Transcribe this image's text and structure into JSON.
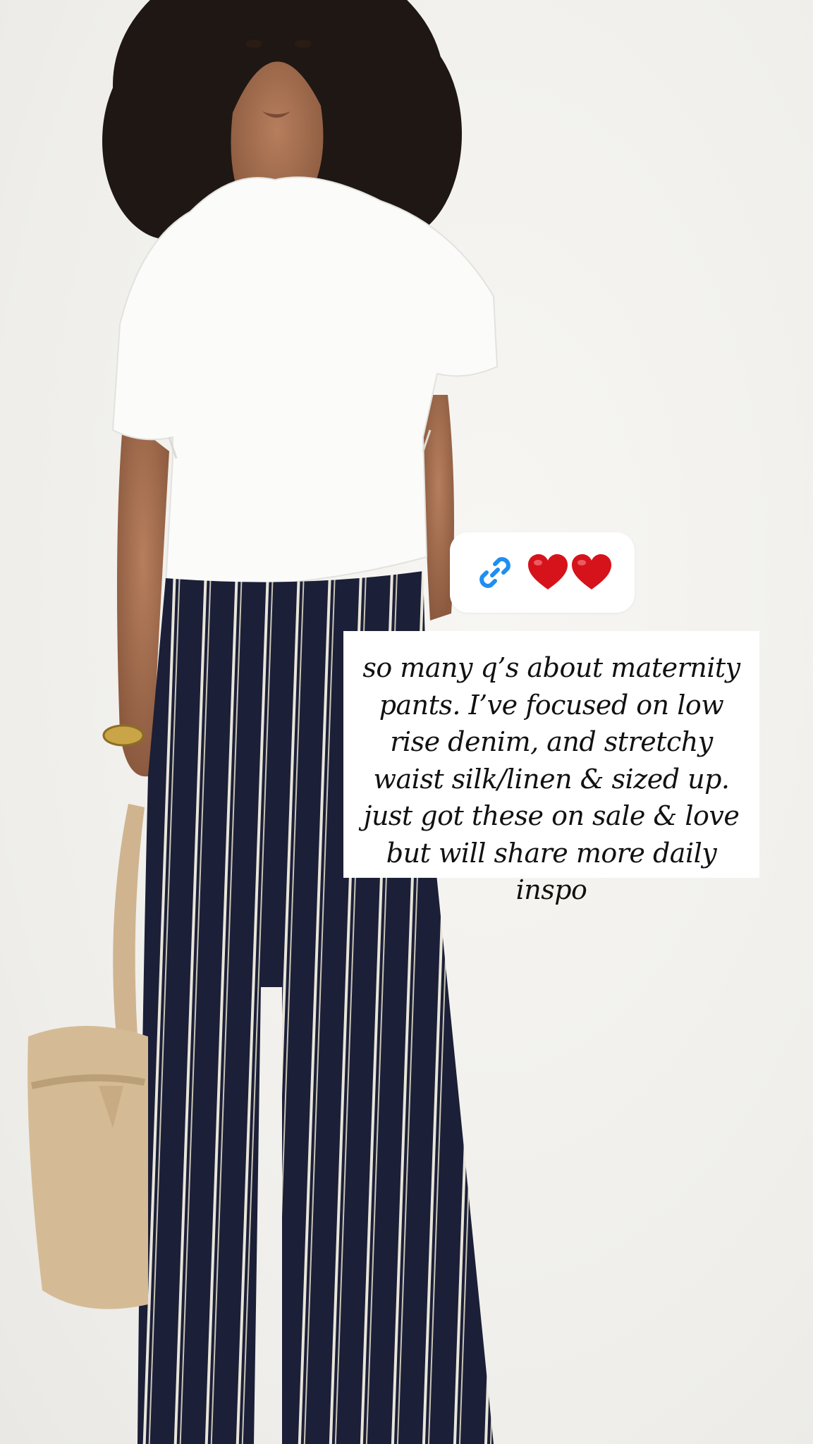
{
  "story": {
    "link_sticker": {
      "icon": "link-icon",
      "emojis": [
        "heart-icon",
        "heart-icon"
      ],
      "colors": {
        "link": "#1f8ef1",
        "heart": "#d6121b"
      }
    },
    "caption": "so many q’s about maternity pants. I’ve focused on low rise denim, and stretchy waist silk/linen & sized up. just got these on sale & love but will share more daily inspo"
  }
}
